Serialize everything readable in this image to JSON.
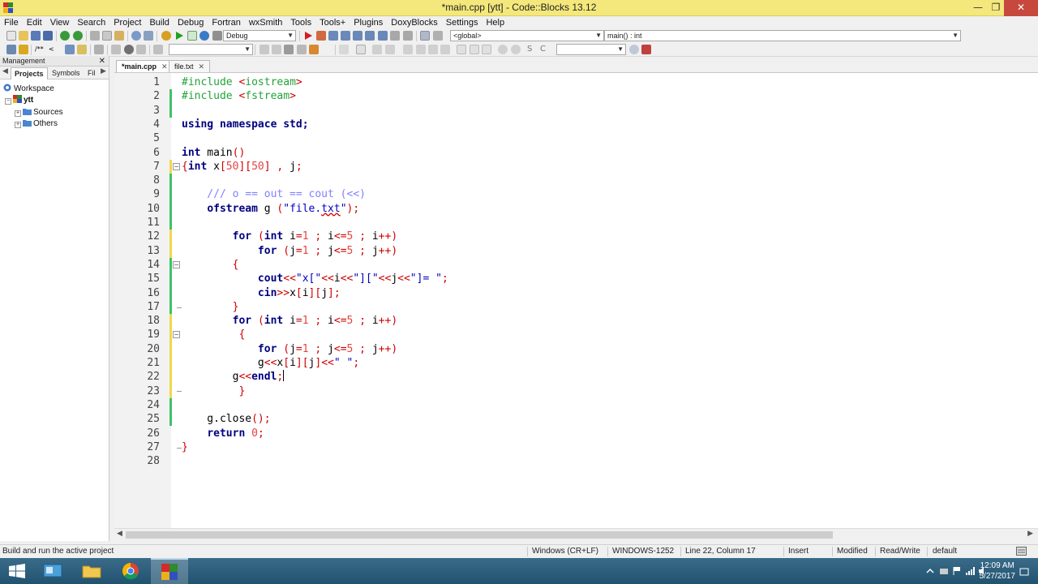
{
  "window": {
    "title": "*main.cpp [ytt] - Code::Blocks 13.12"
  },
  "menu": [
    "File",
    "Edit",
    "View",
    "Search",
    "Project",
    "Build",
    "Debug",
    "Fortran",
    "wxSmith",
    "Tools",
    "Tools+",
    "Plugins",
    "DoxyBlocks",
    "Settings",
    "Help"
  ],
  "toolbar": {
    "build_target": "Debug",
    "scope": "<global>",
    "function": "main() : int"
  },
  "management": {
    "title": "Management",
    "tabs": [
      "Projects",
      "Symbols",
      "Fil"
    ],
    "tree": {
      "workspace": "Workspace",
      "project": "ytt",
      "folders": [
        "Sources",
        "Others"
      ]
    }
  },
  "editor": {
    "tabs": [
      {
        "label": "*main.cpp",
        "active": true
      },
      {
        "label": "file.txt",
        "active": false
      }
    ],
    "line_numbers": [
      "1",
      "2",
      "3",
      "4",
      "5",
      "6",
      "7",
      "8",
      "9",
      "10",
      "11",
      "12",
      "13",
      "14",
      "15",
      "16",
      "17",
      "18",
      "19",
      "20",
      "21",
      "22",
      "23",
      "24",
      "25",
      "26",
      "27",
      "28"
    ],
    "code": [
      "#include <iostream>",
      "#include <fstream>",
      "",
      "using namespace std;",
      "",
      "int main()",
      "{int x[50][50] , j;",
      "",
      "    /// o == out == cout (<<)",
      "    ofstream g (\"file.txt\");",
      "",
      "        for (int i=1 ; i<=5 ; i++)",
      "            for (j=1 ; j<=5 ; j++)",
      "        {",
      "            cout<<\"x[\"<<i<<\"][\"<<j<<\"]= \";",
      "            cin>>x[i][j];",
      "        }",
      "        for (int i=1 ; i<=5 ; i++)",
      "         {",
      "            for (j=1 ; j<=5 ; j++)",
      "            g<<x[i][j]<<\" \";",
      "        g<<endl;",
      "         }",
      "",
      "    g.close();",
      "    return 0;",
      "}",
      ""
    ]
  },
  "statusbar": {
    "message": "Build and run the active project",
    "eol": "Windows (CR+LF)",
    "encoding": "WINDOWS-1252",
    "position": "Line 22, Column 17",
    "mode": "Insert",
    "modified": "Modified",
    "access": "Read/Write",
    "lang": "default"
  },
  "taskbar": {
    "time": "12:09 AM",
    "date": "5/27/2017"
  }
}
